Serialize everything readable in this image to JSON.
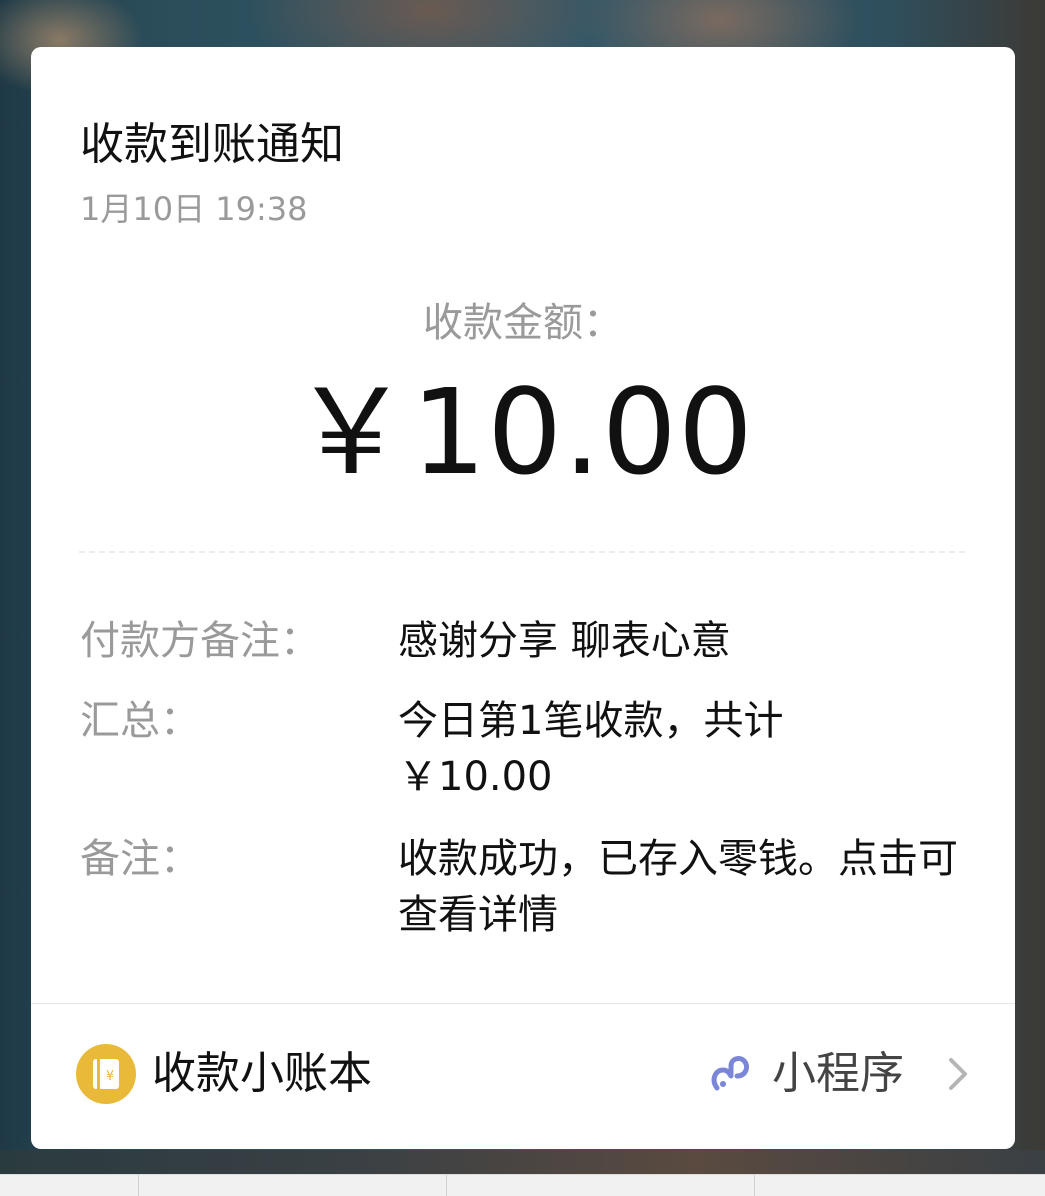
{
  "notification": {
    "title": "收款到账通知",
    "time": "1月10日  19:38",
    "amount_label": "收款金额：",
    "amount": "￥10.00"
  },
  "details": [
    {
      "label": "付款方备注：",
      "value": "感谢分享 聊表心意"
    },
    {
      "label": "汇总：",
      "value": "今日第1笔收款，共计￥10.00"
    },
    {
      "label": "备注：",
      "value": "收款成功，已存入零钱。点击可查看详情"
    }
  ],
  "footer": {
    "app_name": "收款小账本",
    "app_icon": "ledger-yen-icon",
    "mini_program_label": "小程序",
    "mini_program_icon": "mini-program-icon",
    "arrow_icon": "chevron-right-icon"
  },
  "colors": {
    "app_icon_bg": "#e9b93a",
    "mini_program_icon": "#7b87d6",
    "secondary_text": "#9a9a9a",
    "primary_text": "#111111"
  }
}
